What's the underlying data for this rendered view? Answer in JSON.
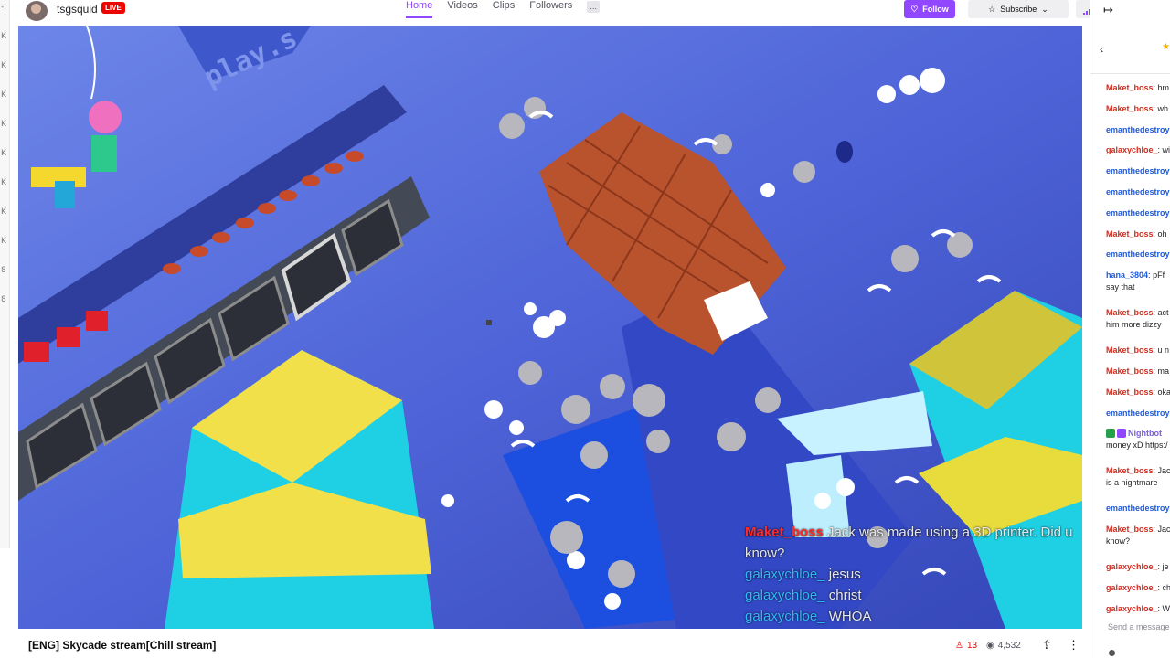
{
  "sidebar": {
    "marks": [
      "-I",
      "K",
      "K",
      "K",
      "K",
      "K",
      "K",
      "K",
      "K",
      "8",
      "8"
    ]
  },
  "channel": {
    "name": "tsgsquid",
    "live_label": "LIVE"
  },
  "nav": {
    "tabs": [
      "Home",
      "Videos",
      "Clips",
      "Followers"
    ],
    "active": "Home",
    "more": "..."
  },
  "actions": {
    "follow": "Follow",
    "subscribe": "Subscribe"
  },
  "video": {
    "sign_text": "play.s",
    "overlay_chat": [
      {
        "user": "Maket_boss",
        "message": "Jack was made using a 3D printer. Did u",
        "cont": "know?"
      },
      {
        "user": "galaxychloe_",
        "message": "jesus"
      },
      {
        "user": "galaxychloe_",
        "message": "christ"
      },
      {
        "user": "galaxychloe_",
        "message": "WHOA"
      }
    ]
  },
  "stream": {
    "title": "[ENG] Skycade stream[Chill stream]",
    "viewers": "13",
    "total_views": "4,532"
  },
  "chat": {
    "collapse_icon": "↦",
    "messages": [
      {
        "user": "Maket_boss",
        "color": "#d02c1e",
        "text": "hm"
      },
      {
        "user": "Maket_boss",
        "color": "#d02c1e",
        "text": "wh"
      },
      {
        "user": "emanthedestroy",
        "color": "#1e5adb",
        "text": ""
      },
      {
        "user": "galaxychloe_",
        "color": "#d02c1e",
        "text": "wi"
      },
      {
        "user": "emanthedestroy",
        "color": "#1e5adb",
        "text": ""
      },
      {
        "user": "emanthedestroy",
        "color": "#1e5adb",
        "text": ""
      },
      {
        "user": "emanthedestroy",
        "color": "#1e5adb",
        "text": ""
      },
      {
        "user": "Maket_boss",
        "color": "#d02c1e",
        "text": "oh"
      },
      {
        "user": "emanthedestroy",
        "color": "#1e5adb",
        "text": ""
      },
      {
        "user": "hana_3804",
        "color": "#1e5adb",
        "text": "pFf",
        "text2": "say that"
      },
      {
        "user": "Maket_boss",
        "color": "#d02c1e",
        "text": "act",
        "text2": "him more dizzy"
      },
      {
        "user": "Maket_boss",
        "color": "#d02c1e",
        "text": "u n"
      },
      {
        "user": "Maket_boss",
        "color": "#d02c1e",
        "text": "ma"
      },
      {
        "user": "Maket_boss",
        "color": "#d02c1e",
        "text": "oka"
      },
      {
        "user": "emanthedestroy",
        "color": "#1e5adb",
        "text": ""
      },
      {
        "user": "Nightbot",
        "color": "#7b5fd6",
        "text": "",
        "text2": "money xD https:/",
        "badges": true
      },
      {
        "user": "Maket_boss",
        "color": "#d02c1e",
        "text": "Jac",
        "text2": "is a nightmare"
      },
      {
        "user": "emanthedestroy",
        "color": "#1e5adb",
        "text": ""
      },
      {
        "user": "Maket_boss",
        "color": "#d02c1e",
        "text": "Jac",
        "text2": "know?"
      },
      {
        "user": "galaxychloe_",
        "color": "#d02c1e",
        "text": "je"
      },
      {
        "user": "galaxychloe_",
        "color": "#d02c1e",
        "text": "ch"
      },
      {
        "user": "galaxychloe_",
        "color": "#d02c1e",
        "text": "Wh"
      }
    ],
    "send_placeholder": "Send a message"
  }
}
